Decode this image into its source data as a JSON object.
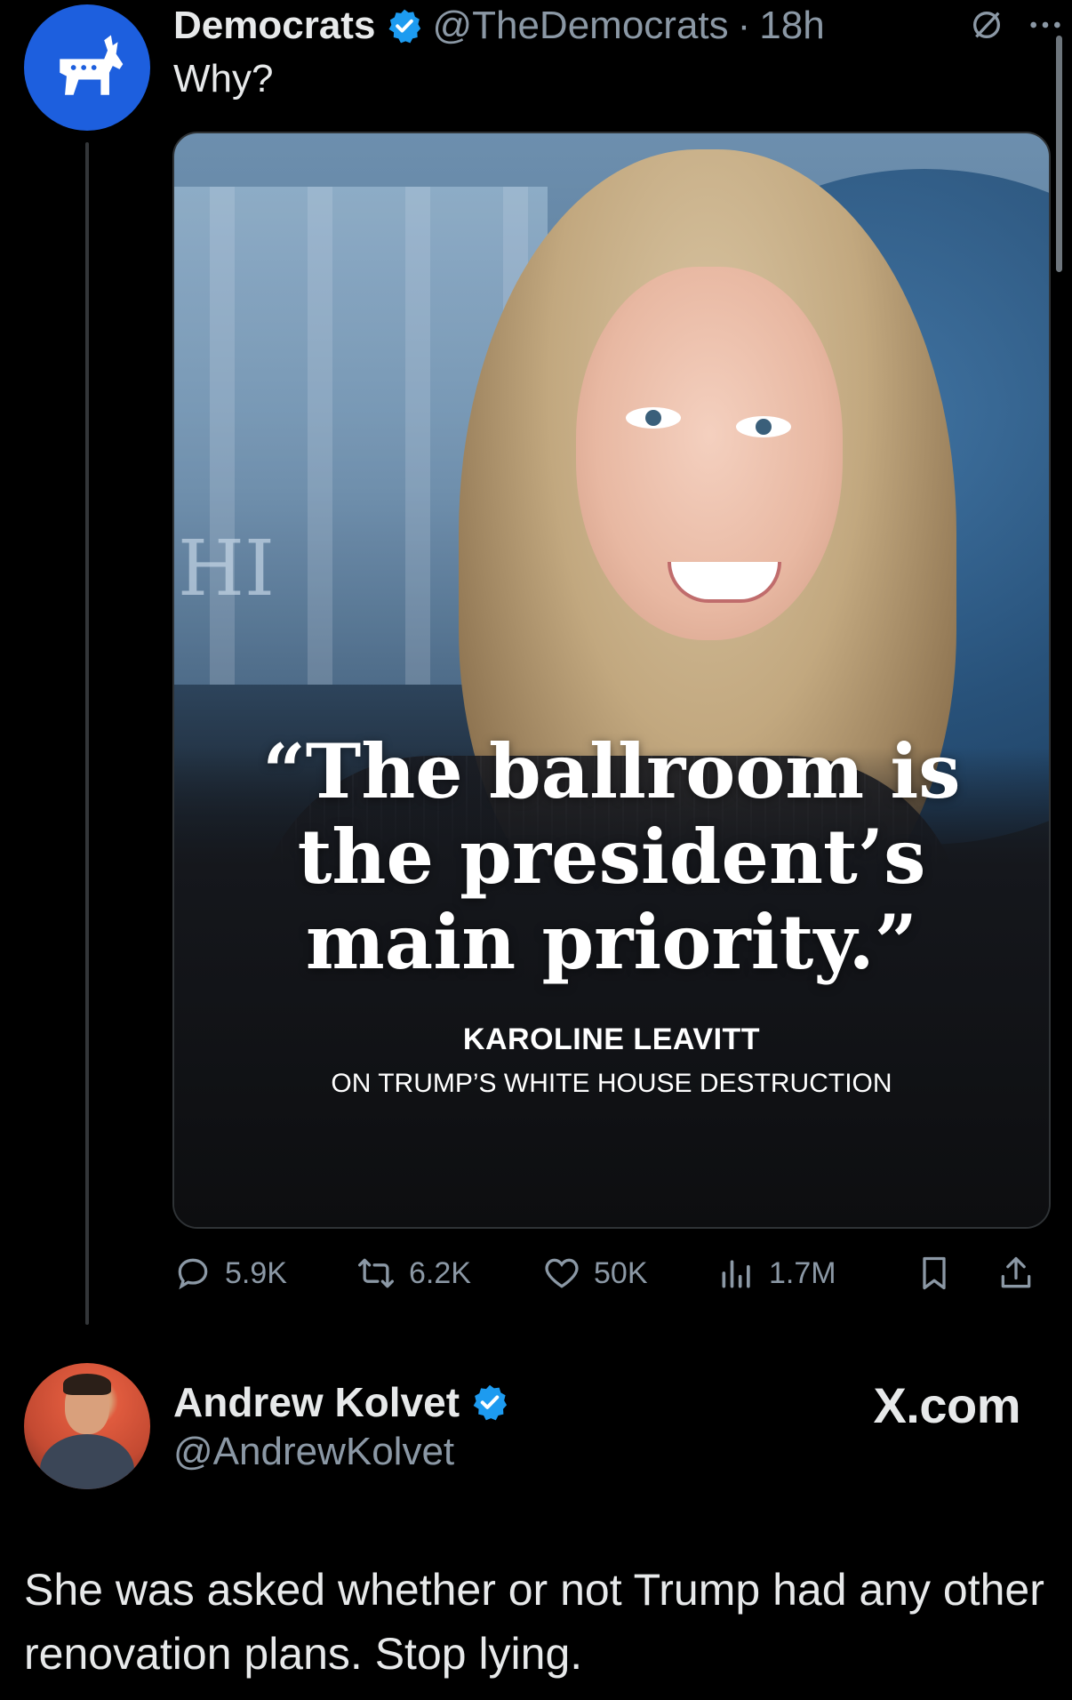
{
  "tweet": {
    "author_name": "Democrats",
    "handle": "@TheDemocrats",
    "separator": "·",
    "time": "18h",
    "text": "Why?",
    "avatar_icon": "donkey-logo-icon",
    "media": {
      "quote": "“The ballroom is\nthe president’s\nmain priority.”",
      "attribution_name": "KAROLINE LEAVITT",
      "attribution_sub": "ON TRUMP’S WHITE HOUSE DESTRUCTION",
      "background_sign_text": "HI"
    },
    "stats": {
      "replies": "5.9K",
      "reposts": "6.2K",
      "likes": "50K",
      "views": "1.7M"
    }
  },
  "reply": {
    "author_name": "Andrew Kolvet",
    "handle": "@AndrewKolvet",
    "source": "X.com",
    "text": "She was asked whether or not Trump had any other renovation plans. Stop lying."
  },
  "colors": {
    "background": "#000000",
    "primary_text": "#e7e9ea",
    "secondary_text": "#8b98a5",
    "verified_blue": "#1d9bf0",
    "democrats_blue": "#1d5fde"
  }
}
